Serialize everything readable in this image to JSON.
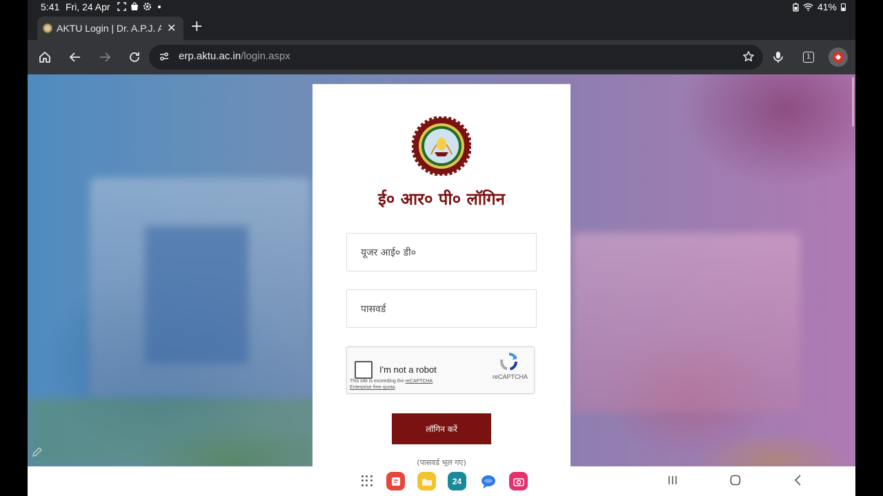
{
  "status_bar": {
    "time": "5:41",
    "date": "Fri, 24 Apr",
    "battery": "41%"
  },
  "browser": {
    "tab": {
      "title": "AKTU Login | Dr. A.P.J. Al"
    },
    "url": {
      "host": "erp.aktu.ac.in",
      "path": "/login.aspx"
    },
    "tab_count": "1"
  },
  "login": {
    "title": "ई० आर० पी० लॉगिन",
    "user_id_placeholder": "यूजर आई० डी०",
    "password_placeholder": "पासवर्ड",
    "recaptcha": {
      "label": "I'm not a robot",
      "brand": "reCAPTCHA",
      "note_prefix": "This site is exceeding the ",
      "note_link": "reCAPTCHA Enterprise free quota",
      "note_suffix": "."
    },
    "submit_label": "लॉगिन करें",
    "forgot_label": "(पासवर्ड भूल गए)"
  },
  "taskbar": {
    "calendar_day": "24"
  },
  "colors": {
    "brand_maroon": "#7a1212",
    "chrome_dark": "#202124",
    "chrome_toolbar": "#35363a"
  }
}
